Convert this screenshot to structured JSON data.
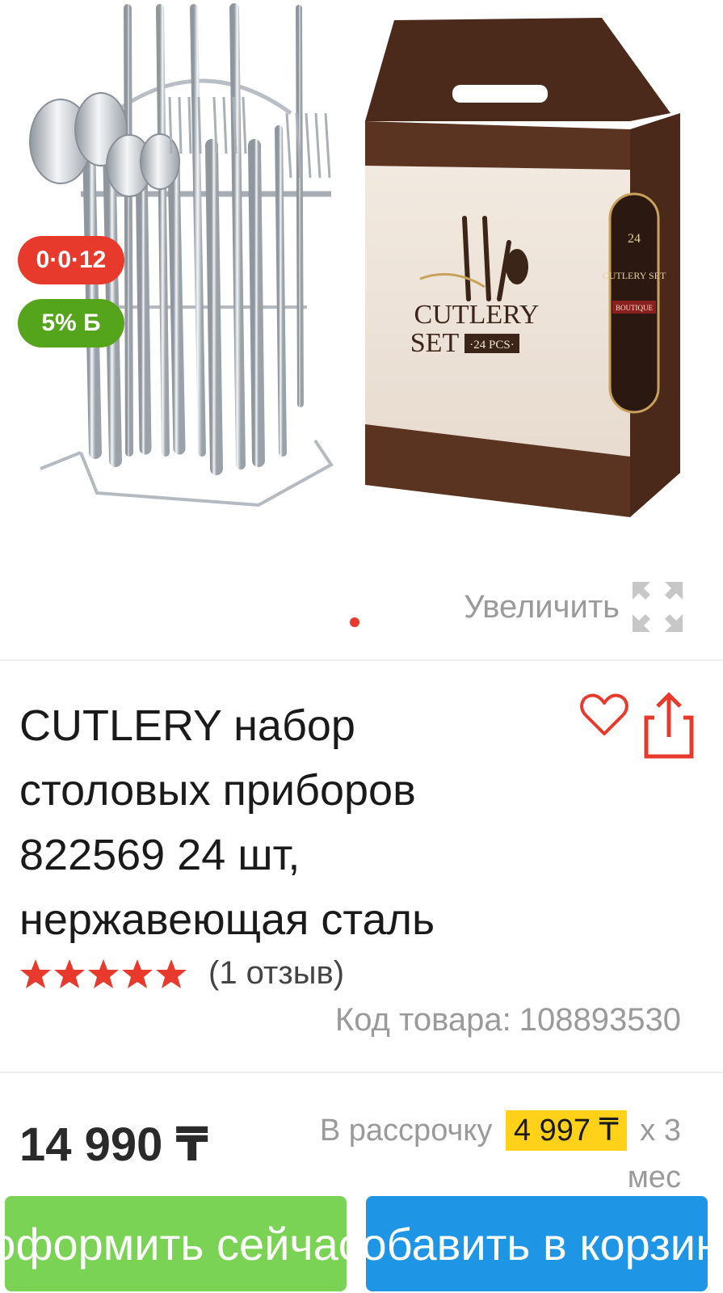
{
  "gallery": {
    "badges": {
      "installment": "0·0·12",
      "bonus": "5% Б"
    },
    "box_text": {
      "line1": "CUTLERY",
      "line2": "SET",
      "pcs": "·24 PCS·",
      "side_title": "CUTLERY SET",
      "side_badge": "BOUTIQUE",
      "side_number": "24"
    },
    "zoom_label": "Увеличить",
    "active_slide": 1
  },
  "product": {
    "title": "CUTLERY набор столовых приборов 822569 24 шт, нержавеющая сталь",
    "rating_value": 5,
    "review_count": "(1 отзыв)",
    "sku_label": "Код товара:",
    "sku_value": "108893530"
  },
  "pricing": {
    "price": "14 990 ₸",
    "installment_prefix": "В рассрочку",
    "installment_amount": "4 997 ₸",
    "installment_suffix": "х 3 мес"
  },
  "buttons": {
    "buy_now": "оформить сейчас",
    "add_to_cart": "Добавить в корзину"
  },
  "colors": {
    "accent_red": "#e8392d",
    "bonus_green": "#55a51c",
    "buy_green": "#7bd356",
    "cart_blue": "#1f95e6",
    "installment_yellow": "#ffd119"
  },
  "icons": [
    "expand-icon",
    "heart-icon",
    "share-icon",
    "star-icon"
  ]
}
